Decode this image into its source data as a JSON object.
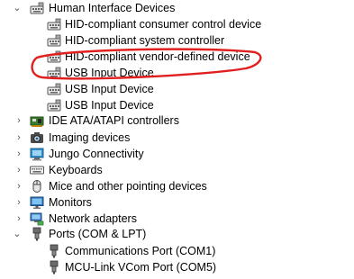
{
  "tree": {
    "human_interface_devices": "Human Interface Devices",
    "hid_children": [
      "HID-compliant consumer control device",
      "HID-compliant system controller",
      "HID-compliant vendor-defined device",
      "USB Input Device",
      "USB Input Device",
      "USB Input Device"
    ],
    "categories": [
      "IDE ATA/ATAPI controllers",
      "Imaging devices",
      "Jungo Connectivity",
      "Keyboards",
      "Mice and other pointing devices",
      "Monitors",
      "Network adapters"
    ],
    "ports": "Ports (COM & LPT)",
    "port_children": [
      "Communications Port (COM1)",
      "MCU-Link VCom Port (COM5)"
    ]
  },
  "annotation": {
    "color": "#e0201f"
  },
  "icons": {
    "hid": "hid-device-icon",
    "ide": "ide-controller-icon",
    "imaging": "camera-icon",
    "jungo": "jungo-icon",
    "keyboard": "keyboard-icon",
    "mouse": "mouse-icon",
    "monitor": "monitor-icon",
    "network": "network-adapter-icon",
    "port": "port-icon"
  }
}
